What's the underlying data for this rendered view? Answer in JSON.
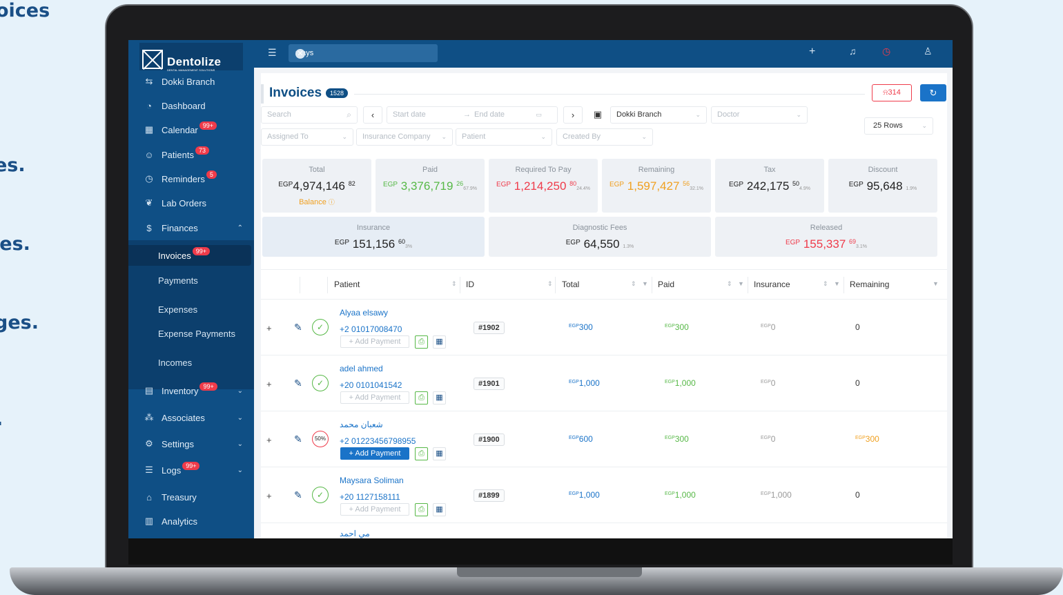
{
  "promo": {
    "lines": [
      "oices",
      "es.",
      "ies.",
      "ges.",
      "."
    ]
  },
  "topbar": {
    "search_value": "mays"
  },
  "logo": {
    "name": "Dentolize",
    "tagline": "DENTAL MANAGEMENT SOLUTIONS"
  },
  "sidebar": {
    "branch": "Dokki Branch",
    "items": [
      {
        "label": "Dashboard",
        "badge": ""
      },
      {
        "label": "Calendar",
        "badge": "99+"
      },
      {
        "label": "Patients",
        "badge": "73"
      },
      {
        "label": "Reminders",
        "badge": "5"
      },
      {
        "label": "Lab Orders",
        "badge": ""
      },
      {
        "label": "Finances",
        "badge": ""
      }
    ],
    "finance_sub": [
      {
        "label": "Invoices",
        "badge": "99+"
      },
      {
        "label": "Payments"
      },
      {
        "label": "Expenses"
      },
      {
        "label": "Expense Payments"
      },
      {
        "label": "Incomes"
      }
    ],
    "lower_items": [
      {
        "label": "Inventory",
        "badge": "99+"
      },
      {
        "label": "Associates",
        "badge": ""
      },
      {
        "label": "Settings",
        "badge": ""
      },
      {
        "label": "Logs",
        "badge": "99+"
      },
      {
        "label": "Treasury",
        "badge": ""
      },
      {
        "label": "Analytics",
        "badge": ""
      }
    ]
  },
  "page": {
    "title": "Invoices",
    "count": "1528",
    "alert_count": "314"
  },
  "filters": {
    "search": "Search",
    "start_date": "Start date",
    "end_date": "End date",
    "branch": "Dokki Branch",
    "doctor": "Doctor",
    "rows": "25 Rows",
    "assigned_to": "Assigned To",
    "insurance_company": "Insurance Company",
    "patient": "Patient",
    "created_by": "Created By"
  },
  "stats": {
    "total": {
      "label": "Total",
      "cur": "EGP",
      "int": "4,974,146",
      "dec": "82",
      "pct": "",
      "sub": "Balance"
    },
    "paid": {
      "label": "Paid",
      "cur": "EGP",
      "int": "3,376,719",
      "dec": "26",
      "pct": "67.9%"
    },
    "required": {
      "label": "Required To Pay",
      "cur": "EGP",
      "int": "1,214,250",
      "dec": "80",
      "pct": "24.4%"
    },
    "remaining": {
      "label": "Remaining",
      "cur": "EGP",
      "int": "1,597,427",
      "dec": "56",
      "pct": "32.1%"
    },
    "tax": {
      "label": "Tax",
      "cur": "EGP",
      "int": "242,175",
      "dec": "50",
      "pct": "4.9%"
    },
    "discount": {
      "label": "Discount",
      "cur": "EGP",
      "int": "95,648",
      "dec": "",
      "pct": "1.9%"
    },
    "insurance": {
      "label": "Insurance",
      "cur": "EGP",
      "int": "151,156",
      "dec": "60",
      "pct": "3%"
    },
    "diagnostic": {
      "label": "Diagnostic Fees",
      "cur": "EGP",
      "int": "64,550",
      "dec": "",
      "pct": "1.3%"
    },
    "released": {
      "label": "Released",
      "cur": "EGP",
      "int": "155,337",
      "dec": "69",
      "pct": "3.1%"
    }
  },
  "table": {
    "headers": [
      "Patient",
      "ID",
      "Total",
      "Paid",
      "Insurance",
      "Remaining"
    ],
    "add_payment_label": "+ Add Payment",
    "rows": [
      {
        "name": "Alyaa elsawy",
        "phone": "+2 01017008470",
        "id": "#1902",
        "total": "300",
        "paid": "300",
        "insurance": "0",
        "remaining": "0",
        "status": "✓"
      },
      {
        "name": "adel ahmed",
        "phone": "+20 0101041542",
        "id": "#1901",
        "total": "1,000",
        "paid": "1,000",
        "insurance": "0",
        "remaining": "0",
        "status": "✓"
      },
      {
        "name": "شعبان محمد",
        "phone": "+2 01223456798955",
        "id": "#1900",
        "total": "600",
        "paid": "300",
        "insurance": "0",
        "remaining": "300",
        "status": "50%"
      },
      {
        "name": "Maysara Soliman",
        "phone": "+20 1127158111",
        "id": "#1899",
        "total": "1,000",
        "paid": "1,000",
        "insurance": "1,000",
        "remaining": "0",
        "status": "✓"
      },
      {
        "name": "مي احمد",
        "phone": "",
        "id": "",
        "total": "",
        "paid": "",
        "insurance": "",
        "remaining": "",
        "status": ""
      }
    ],
    "currency": "EGP"
  },
  "colors": {
    "sidebar": "#0f4f85",
    "accent": "#1a73c8",
    "green": "#56b846",
    "red": "#ef3b4a",
    "orange": "#f0a020"
  }
}
